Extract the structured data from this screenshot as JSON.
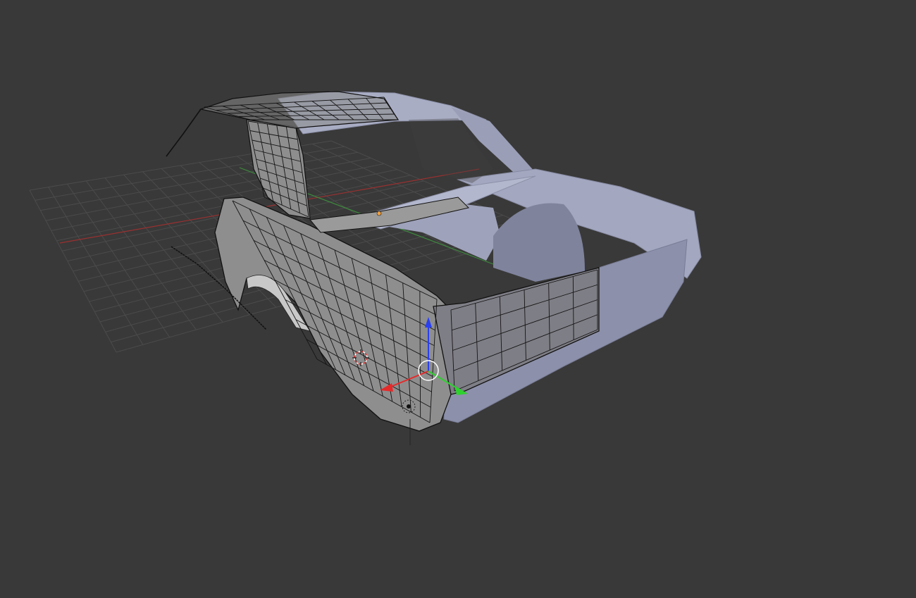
{
  "viewport": {
    "background": "#393939",
    "grid_color": "#4b4b4b",
    "x_axis_color": "#9a3030",
    "y_axis_color": "#3e8a3e",
    "mesh_wire_color": "#111111",
    "mesh_solid_color": "#8e8e8e",
    "reference_color": "#a9adc4",
    "gizmo": {
      "x_color": "#e52a2a",
      "y_color": "#2ed22e",
      "z_color": "#2a3ff0"
    }
  }
}
